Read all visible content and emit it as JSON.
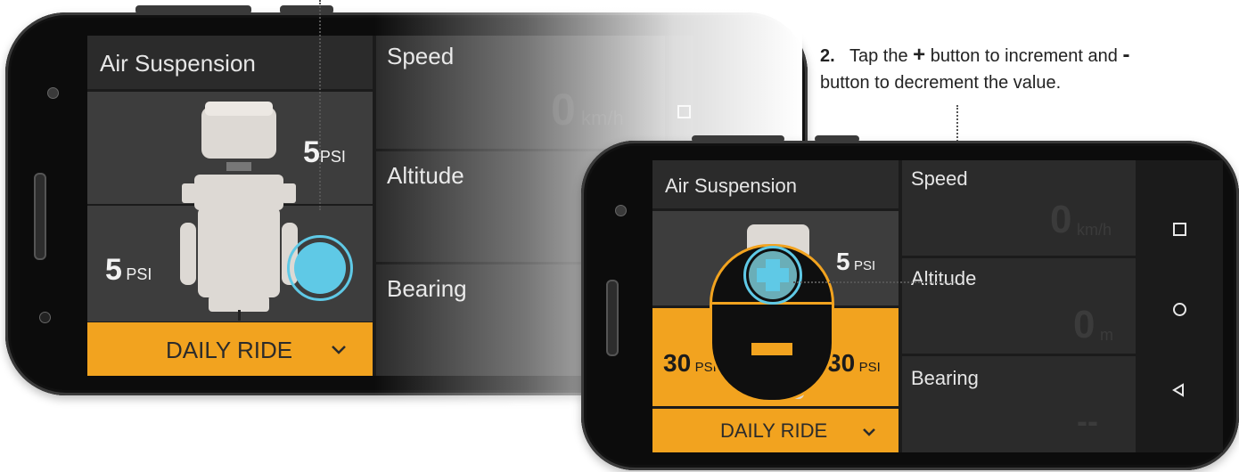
{
  "instruction": {
    "step": "2.",
    "text_before": "Tap the",
    "plus_symbol": "+",
    "text_middle": "button to increment and",
    "minus_symbol": "-",
    "text_after": "button to decrement the value."
  },
  "left_screen": {
    "title": "Air Suspension",
    "front_pressure": {
      "value": "5",
      "unit": "PSI"
    },
    "rear_pressure": {
      "value": "5",
      "unit": "PSI"
    },
    "mode_label": "DAILY RIDE",
    "speed_label": "Speed",
    "speed_value": "0",
    "speed_unit": "km/h",
    "altitude_label": "Altitude",
    "bearing_label": "Bearing"
  },
  "right_screen": {
    "title": "Air Suspension",
    "front_pressure": {
      "value": "5",
      "unit": "PSI"
    },
    "rear_left_pressure": {
      "value": "30",
      "unit": "PSI"
    },
    "rear_right_pressure": {
      "value": "30",
      "unit": "PSI"
    },
    "mode_label": "DAILY RIDE",
    "speed_label": "Speed",
    "speed_value": "0",
    "speed_unit": "km/h",
    "altitude_label": "Altitude",
    "altitude_value": "0",
    "altitude_unit": "m",
    "bearing_label": "Bearing",
    "bearing_value": "--"
  },
  "nav_icons": [
    "recent-apps-icon",
    "home-icon",
    "back-icon"
  ],
  "colors": {
    "accent_orange": "#f2a31f",
    "touch_blue": "#5fc9e6",
    "panel_dark": "#2b2b2b",
    "panel_mid": "#3d3d3d"
  }
}
